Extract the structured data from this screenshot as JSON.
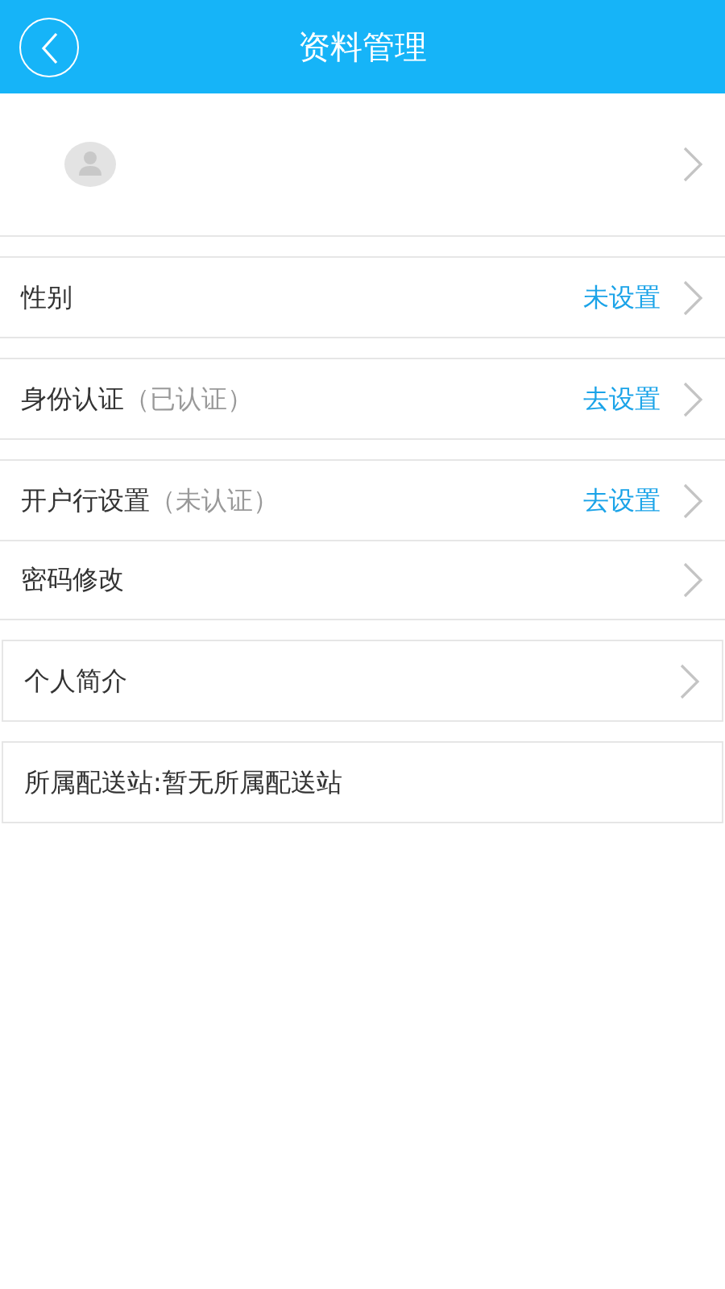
{
  "header": {
    "title": "资料管理"
  },
  "sections": [
    {
      "framed": false,
      "rows": [
        {
          "kind": "link",
          "label": "性别",
          "action": "未设置"
        }
      ]
    },
    {
      "framed": false,
      "rows": [
        {
          "kind": "link",
          "label": "身份认证",
          "note": "（已认证）",
          "action": "去设置"
        }
      ]
    },
    {
      "framed": false,
      "rows": [
        {
          "kind": "link",
          "label": "开户行设置",
          "note": "（未认证）",
          "action": "去设置"
        },
        {
          "kind": "link",
          "label": "密码修改"
        }
      ]
    },
    {
      "framed": true,
      "rows": [
        {
          "kind": "link",
          "label": "个人简介"
        }
      ]
    },
    {
      "framed": true,
      "rows": [
        {
          "kind": "info",
          "label": "所属配送站:暂无所属配送站"
        }
      ]
    }
  ]
}
